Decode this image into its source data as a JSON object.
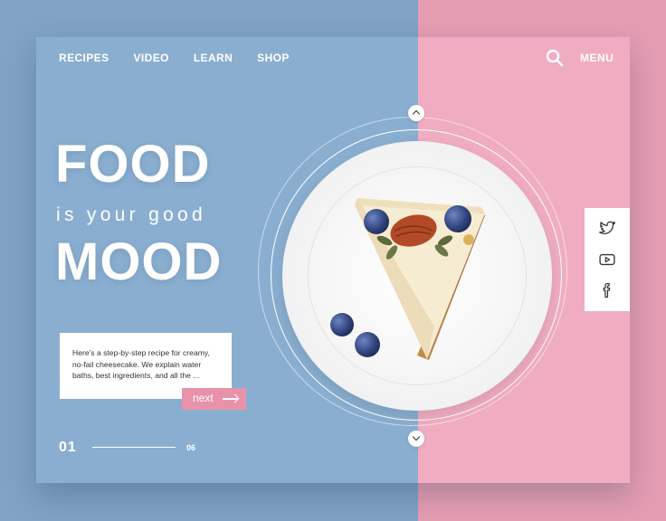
{
  "nav": {
    "items": [
      {
        "label": "RECIPES"
      },
      {
        "label": "VIDEO"
      },
      {
        "label": "LEARN"
      },
      {
        "label": "SHOP"
      }
    ],
    "menu_label": "MENU"
  },
  "hero": {
    "line1": "FOOD",
    "line2": "is your good",
    "line3": "MOOD"
  },
  "description": "Here's a step-by-step recipe for creamy, no-fail cheesecake. We explain water baths, best ingredients, and all the ...",
  "next_label": "next",
  "pager": {
    "current": "01",
    "total": "06"
  },
  "icons": {
    "search": "search-icon",
    "twitter": "twitter-icon",
    "youtube": "youtube-icon",
    "facebook": "facebook-icon",
    "up": "chevron-up-icon",
    "down": "chevron-down-icon"
  },
  "colors": {
    "blue_panel": "#8aaed0",
    "pink_panel": "#f0adc1",
    "accent_pink": "#e892aa",
    "background_blue": "#7fa2c6",
    "background_pink": "#e59db3"
  }
}
